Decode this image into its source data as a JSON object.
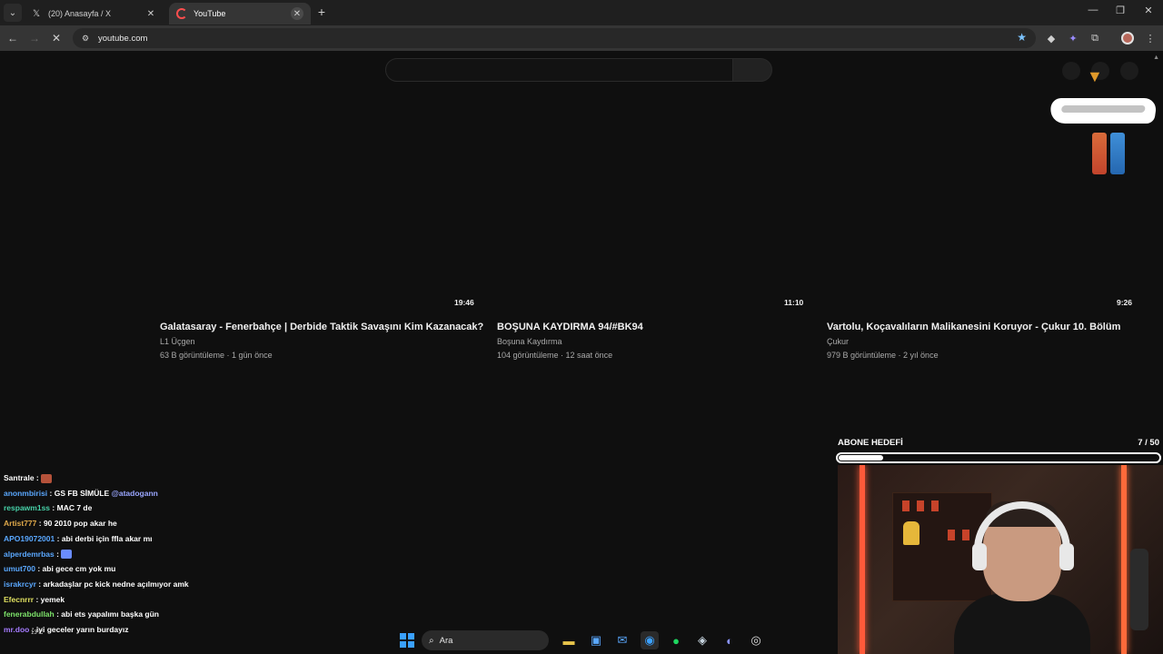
{
  "browser": {
    "tabs": [
      {
        "title": "(20) Anasayfa / X",
        "icon": "x-logo-icon",
        "active": false
      },
      {
        "title": "YouTube",
        "icon": "youtube-icon",
        "active": true
      }
    ],
    "url": "youtube.com"
  },
  "videos": [
    {
      "duration": "19:46",
      "title": "Galatasaray - Fenerbahçe | Derbide Taktik Savaşını Kim Kazanacak?",
      "channel": "L1 Üçgen",
      "meta": "63 B görüntüleme · 1 gün önce"
    },
    {
      "duration": "11:10",
      "title": "BOŞUNA KAYDIRMA 94/#BK94",
      "channel": "Boşuna Kaydırma",
      "meta": "104 görüntüleme · 12 saat önce"
    },
    {
      "duration": "9:26",
      "title": "Vartolu, Koçavalıların Malikanesini Koruyor - Çukur 10. Bölüm",
      "channel": "Çukur",
      "meta": "979 B görüntüleme · 2 yıl önce"
    }
  ],
  "goal": {
    "label": "ABONE HEDEFİ",
    "count": "7 / 50",
    "progress": 0.14
  },
  "chat": [
    {
      "user": "Santrale",
      "color": "#ffffff",
      "text": "",
      "emote": "#b5523a"
    },
    {
      "user": "anonmbirisi",
      "color": "#5aa8ff",
      "text": "GS FB SİMÜLE",
      "mention": "@atadogann"
    },
    {
      "user": "respawm1ss",
      "color": "#47d1a8",
      "text": "MAC 7 de"
    },
    {
      "user": "Artist777",
      "color": "#e0a94a",
      "text": "90 2010 pop akar he"
    },
    {
      "user": "APO19072001",
      "color": "#5aa8ff",
      "text": "abi derbi için ffla akar mı"
    },
    {
      "user": "alperdemrbas",
      "color": "#5aa8ff",
      "text": "",
      "emote": "#6a8cff"
    },
    {
      "user": "umut700",
      "color": "#5aa8ff",
      "text": "abi gece cm yok mu"
    },
    {
      "user": "israkrcyr",
      "color": "#5aa8ff",
      "text": "arkadaşlar pc kick nedne açılmıyor amk"
    },
    {
      "user": "Efecnrrr",
      "color": "#e0e060",
      "text": "yemek"
    },
    {
      "user": "fenerabdullah",
      "color": "#7de36a",
      "text": "abi ets yapalımı başka gün"
    },
    {
      "user": "mr.doo",
      "color": "#a57bff",
      "text": "iyi geceler yarın burdayız"
    }
  ],
  "taskbar": {
    "search_label": "Ara",
    "weather": "13°C"
  }
}
